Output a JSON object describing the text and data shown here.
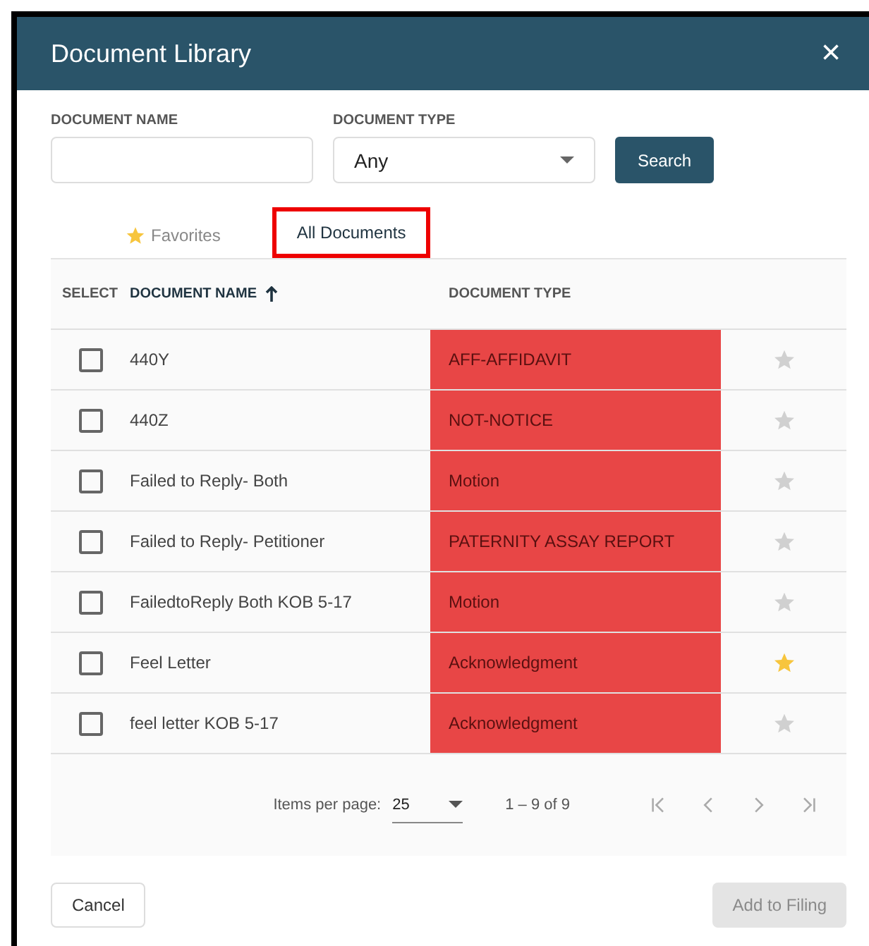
{
  "dialog": {
    "title": "Document Library",
    "close": "×"
  },
  "filters": {
    "name_label": "DOCUMENT NAME",
    "type_label": "DOCUMENT TYPE",
    "type_value": "Any",
    "search": "Search"
  },
  "tabs": [
    {
      "label": "Favorites",
      "selected": false,
      "outlined": false
    },
    {
      "label": "All Documents",
      "selected": true,
      "outlined": true
    }
  ],
  "table": {
    "columns": [
      {
        "label": "SELECT",
        "sorted": false
      },
      {
        "label": "DOCUMENT NAME",
        "sorted": true
      },
      {
        "label": "DOCUMENT TYPE",
        "sorted": false
      }
    ],
    "rows": [
      {
        "name": "440Y",
        "type": "AFF-AFFIDAVIT",
        "checked": false,
        "favorite": false,
        "highlighted": true
      },
      {
        "name": "440Z",
        "type": "NOT-NOTICE",
        "checked": false,
        "favorite": false,
        "highlighted": true
      },
      {
        "name": "Failed to Reply- Both",
        "type": "Motion",
        "checked": false,
        "favorite": false,
        "highlighted": true
      },
      {
        "name": "Failed to Reply- Petitioner",
        "type": "PATERNITY ASSAY REPORT",
        "checked": false,
        "favorite": false,
        "highlighted": true
      },
      {
        "name": "FailedtoReply Both KOB 5-17",
        "type": "Motion",
        "checked": false,
        "favorite": false,
        "highlighted": true
      },
      {
        "name": "Feel Letter",
        "type": "Acknowledgment",
        "checked": false,
        "favorite": true,
        "highlighted": true
      },
      {
        "name": "feel letter KOB 5-17",
        "type": "Acknowledgment",
        "checked": false,
        "favorite": false,
        "highlighted": true
      }
    ]
  },
  "paginator": {
    "label": "Items per page:",
    "page_size": "25",
    "range": "1 – 9 of 9"
  },
  "footer": {
    "cancel": "Cancel",
    "add": "Add to Filing",
    "add_disabled": true
  }
}
